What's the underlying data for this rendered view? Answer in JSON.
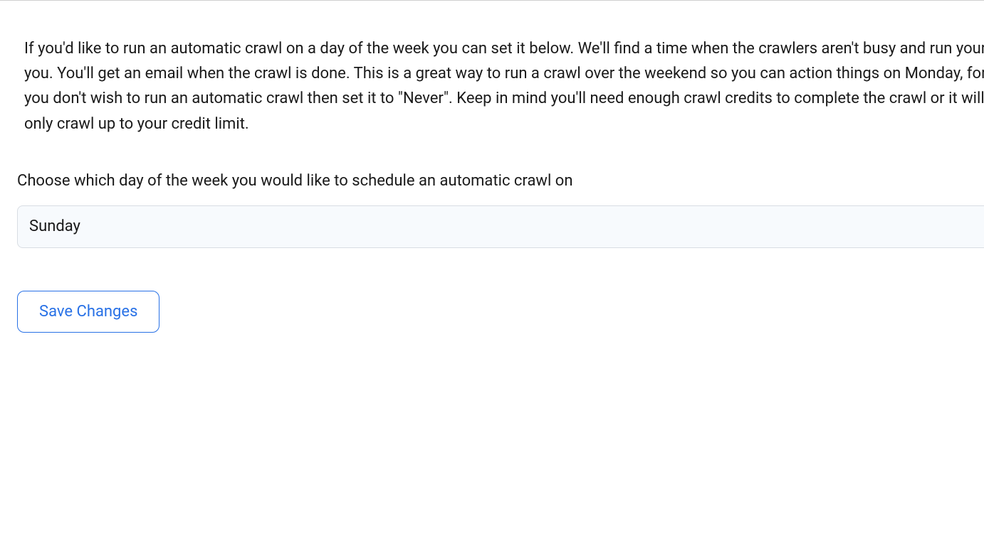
{
  "description": "If you'd like to run an automatic crawl on a day of the week you can set it below. We'll find a time when the crawlers aren't busy and run your crawl for you. You'll get an email when the crawl is done. This is a great way to run a crawl over the weekend so you can action things on Monday, for example. If you don't wish to run an automatic crawl then set it to \"Never\". Keep in mind you'll need enough crawl credits to complete the crawl or it will not run or only crawl up to your credit limit.",
  "form": {
    "day_label": "Choose which day of the week you would like to schedule an automatic crawl on",
    "selected_day": "Sunday",
    "save_label": "Save Changes"
  }
}
